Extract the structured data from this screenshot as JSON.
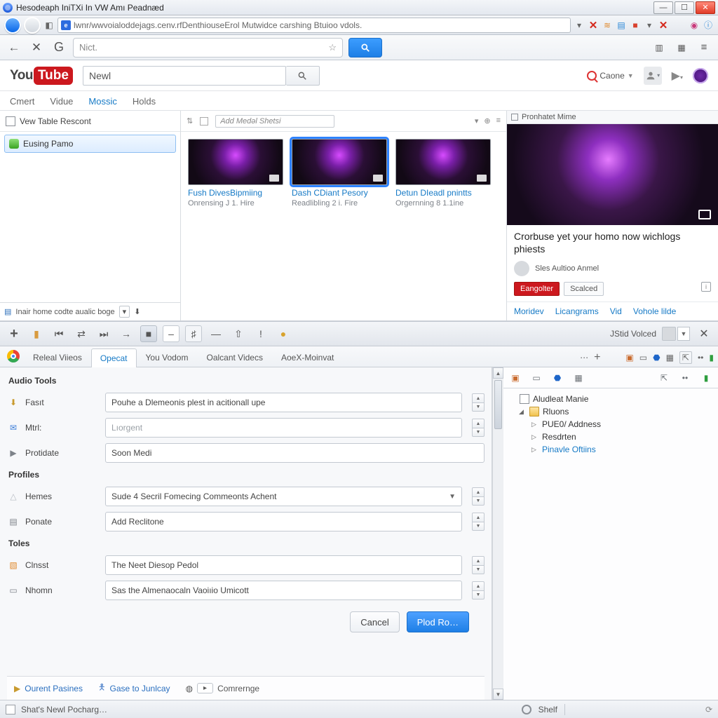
{
  "window": {
    "title": "Hesodeaph IniTXi In VW Amı Peadnæd"
  },
  "navstrip": {
    "url": "lwnr/wwvoialoddejags.cenv.rfDenthiouseErol Mutwidce carshing Btuioo vdols."
  },
  "toolbar2": {
    "search_value": "Nict."
  },
  "youtube": {
    "logo_you": "You",
    "logo_tube": "Tube",
    "search_value": "Newl",
    "caone_label": "Caone",
    "tabs": [
      "Cmert",
      "Vidue",
      "Mossic",
      "Holds"
    ]
  },
  "lefttree": {
    "header": "Vew Table Rescont",
    "item": "Eusing Pamo",
    "footer_label": "Inair home codte aualic boge"
  },
  "midthumbs": {
    "addmed_placeholder": "Add Medəl Shetsi",
    "items": [
      {
        "title": "Fush DivesBipmiing",
        "sub": "Onrensing J 1. Hire"
      },
      {
        "title": "Dash CDiant Pesory",
        "sub": "Readlibling 2 i. Fire"
      },
      {
        "title": "Detun DIeadl pnintts",
        "sub": "Orgernning 8 1.1ine"
      }
    ]
  },
  "rightplayer": {
    "header": "Pronhatet Mime",
    "title": "Crorbuse yet your homo now wichlogs phiests",
    "author": "Sles Aultioo Anmel",
    "btn_register": "Eangolter",
    "btn_scaled": "Scalced",
    "links": [
      "Moridev",
      "Licangrams",
      "Vid",
      "Vohole lilde"
    ]
  },
  "midtoolbar": {
    "label": "JStid Volced"
  },
  "lowtabs": {
    "items": [
      "Releal Viieos",
      "Opecat",
      "You Vodom",
      "Oalcant Videcs",
      "AoeX-Moinvat"
    ]
  },
  "form": {
    "section_audio": "Audio Tools",
    "section_profiles": "Profiles",
    "section_toles": "Toles",
    "rows": {
      "fast_label": "Fasıt",
      "fast_value": "Pouhe a Dlemeonis plest in acitionall upe",
      "mtl_label": "Mtrl:",
      "mtl_value": "Lıorgent",
      "prod_label": "Protidate",
      "prod_value": "Soon Medi",
      "hemes_label": "Hemes",
      "hemes_value": "Sude 4 Secril Fomecing Commeonts Achent",
      "ponate_label": "Ponate",
      "ponate_value": "Add Reclitone",
      "clnsst_label": "Clnsst",
      "clnsst_value": "The Neet Diesop Pedol",
      "nhomn_label": "Nhomn",
      "nhomn_value": "Sas the Almenaocaln Vaoiıio Umicott"
    },
    "cancel": "Cancel",
    "submit": "Plod Ro…",
    "bottom": {
      "ourent": "Ourent Pasines",
      "gase": "Gase to Junlcay",
      "comrernge": "Comrernge"
    }
  },
  "rtree": {
    "root": "Aludleat Manie",
    "folder": "Rluons",
    "children": [
      "PUE0/ Addness",
      "Resdrten",
      "Pinavle Oftiins"
    ]
  },
  "statusbar": {
    "left": "Shat's Newl Pocharg…",
    "shelf": "Shelf"
  }
}
